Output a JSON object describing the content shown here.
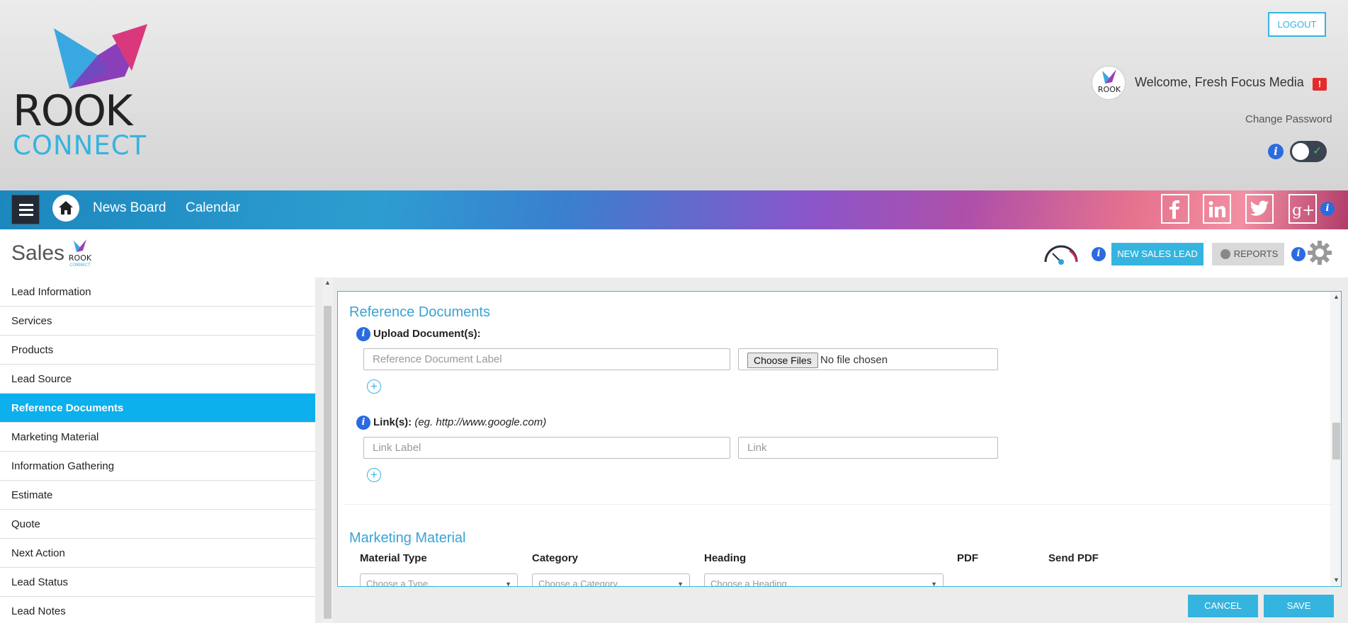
{
  "header": {
    "logo_word1": "ROOK",
    "logo_word2": "CONNECT",
    "logout_label": "LOGOUT",
    "welcome_text": "Welcome, Fresh Focus Media",
    "alert_label": "!",
    "change_password_label": "Change Password"
  },
  "nav": {
    "links": [
      "News Board",
      "Calendar"
    ],
    "social": [
      "facebook-icon",
      "linkedin-icon",
      "twitter-icon",
      "google-plus-icon"
    ]
  },
  "page": {
    "title": "Sales",
    "new_sales_lead_label": "NEW SALES LEAD",
    "reports_label": "REPORTS"
  },
  "sidebar": {
    "items": [
      {
        "label": "Lead Information"
      },
      {
        "label": "Services"
      },
      {
        "label": "Products"
      },
      {
        "label": "Lead Source"
      },
      {
        "label": "Reference Documents",
        "active": true
      },
      {
        "label": "Marketing Material"
      },
      {
        "label": "Information Gathering"
      },
      {
        "label": "Estimate"
      },
      {
        "label": "Quote"
      },
      {
        "label": "Next Action"
      },
      {
        "label": "Lead Status"
      },
      {
        "label": "Lead Notes"
      }
    ]
  },
  "reference_documents": {
    "title": "Reference Documents",
    "upload_label": "Upload Document(s):",
    "doc_label_placeholder": "Reference Document Label",
    "choose_files_label": "Choose Files",
    "no_file_text": "No file chosen",
    "links_label": "Link(s):",
    "links_example": "(eg. http://www.google.com)",
    "link_label_placeholder": "Link Label",
    "link_placeholder": "Link"
  },
  "marketing_material": {
    "title": "Marketing Material",
    "columns": [
      "Material Type",
      "Category",
      "Heading",
      "PDF",
      "Send PDF"
    ],
    "type_placeholder": "Choose a Type...",
    "category_placeholder": "Choose a Category...",
    "heading_placeholder": "Choose a Heading..."
  },
  "footer": {
    "cancel_label": "CANCEL",
    "save_label": "SAVE"
  }
}
